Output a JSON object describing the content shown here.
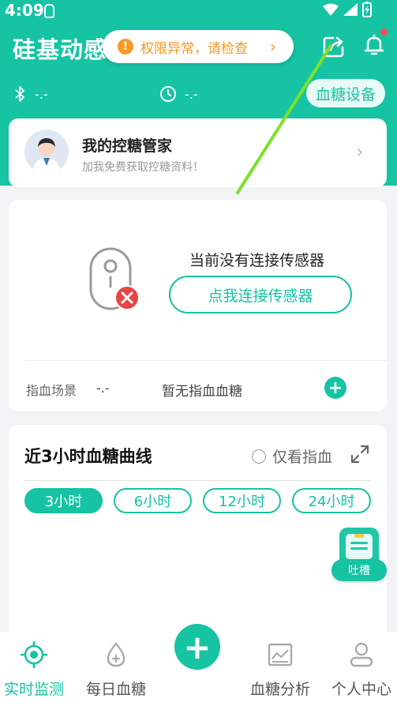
{
  "status_bar": {
    "time": "4:09"
  },
  "header": {
    "title": "硅基动感",
    "warning": {
      "text": "权限异常，请检查",
      "color": "#f59a23"
    },
    "bluetooth_value": "-.-",
    "timer_value": "-.-",
    "device_button": "血糖设备",
    "accent_color": "#16c3a3"
  },
  "manager_card": {
    "title": "我的控糖管家",
    "subtitle": "加我免费获取控糖资料！"
  },
  "sensor_card": {
    "status_text": "当前没有连接传感器",
    "connect_button": "点我连接传感器",
    "finger_label": "指血场景",
    "finger_value": "-.-",
    "finger_none": "暂无指血血糖"
  },
  "curve_card": {
    "title": "近3小时血糖曲线",
    "only_finger": "仅看指血",
    "tabs": [
      {
        "label": "3小时",
        "active": true
      },
      {
        "label": "6小时",
        "active": false
      },
      {
        "label": "12小时",
        "active": false
      },
      {
        "label": "24小时",
        "active": false
      }
    ]
  },
  "feedback": {
    "label": "吐槽"
  },
  "bottom_nav": {
    "items": [
      {
        "label": "实时监测",
        "icon": "crosshair-icon",
        "active": true
      },
      {
        "label": "每日血糖",
        "icon": "blood-drop-plus-icon",
        "active": false
      },
      {
        "label": "血糖分析",
        "icon": "chart-image-icon",
        "active": false
      },
      {
        "label": "个人中心",
        "icon": "user-icon",
        "active": false
      }
    ]
  }
}
